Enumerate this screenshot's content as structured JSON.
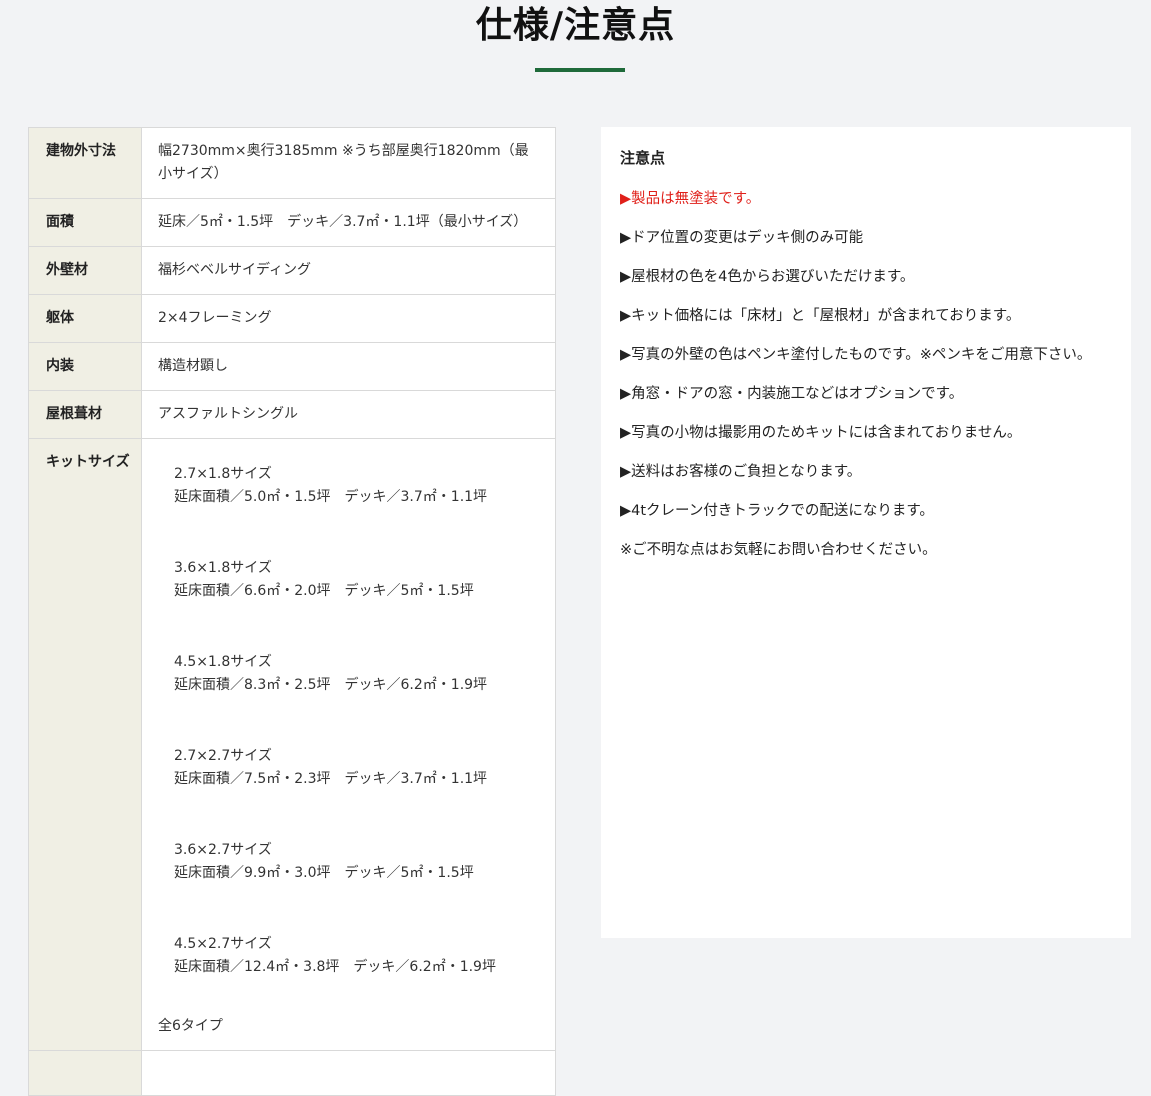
{
  "page": {
    "title": "仕様/注意点",
    "accent_color": "#1f6a3a"
  },
  "specs": {
    "rows": [
      {
        "label": "建物外寸法",
        "value": "幅2730mm×奥行3185mm ※うち部屋奥行1820mm（最小サイズ）"
      },
      {
        "label": "面積",
        "value": "延床／5㎡・1.5坪　デッキ／3.7㎡・1.1坪（最小サイズ）"
      },
      {
        "label": "外壁材",
        "value": "福杉ベベルサイディング"
      },
      {
        "label": "躯体",
        "value": "2×4フレーミング"
      },
      {
        "label": "内装",
        "value": "構造材顕し"
      },
      {
        "label": "屋根葺材",
        "value": "アスファルトシングル"
      }
    ],
    "kit": {
      "label": "キットサイズ",
      "sizes": [
        {
          "name": "2.7×1.8サイズ",
          "detail": "延床面積／5.0㎡・1.5坪　デッキ／3.7㎡・1.1坪"
        },
        {
          "name": "3.6×1.8サイズ",
          "detail": "延床面積／6.6㎡・2.0坪　デッキ／5㎡・1.5坪"
        },
        {
          "name": "4.5×1.8サイズ",
          "detail": "延床面積／8.3㎡・2.5坪　デッキ／6.2㎡・1.9坪"
        },
        {
          "name": "2.7×2.7サイズ",
          "detail": "延床面積／7.5㎡・2.3坪　デッキ／3.7㎡・1.1坪"
        },
        {
          "name": "3.6×2.7サイズ",
          "detail": "延床面積／9.9㎡・3.0坪　デッキ／5㎡・1.5坪"
        },
        {
          "name": "4.5×2.7サイズ",
          "detail": "延床面積／12.4㎡・3.8坪　デッキ／6.2㎡・1.9坪"
        }
      ],
      "total": "全6タイプ"
    }
  },
  "notes": {
    "title": "注意点",
    "highlight_color": "#e0201a",
    "items": [
      "▶製品は無塗装です。",
      "▶ドア位置の変更はデッキ側のみ可能",
      "▶屋根材の色を4色からお選びいただけます。",
      "▶キット価格には「床材」と「屋根材」が含まれております。",
      "▶写真の外壁の色はペンキ塗付したものです。※ペンキをご用意下さい。",
      "▶角窓・ドアの窓・内装施工などはオプションです。",
      "▶写真の小物は撮影用のためキットには含まれておりません。",
      "▶送料はお客様のご負担となります。",
      "▶4tクレーン付きトラックでの配送になります。",
      "※ご不明な点はお気軽にお問い合わせください。"
    ]
  }
}
